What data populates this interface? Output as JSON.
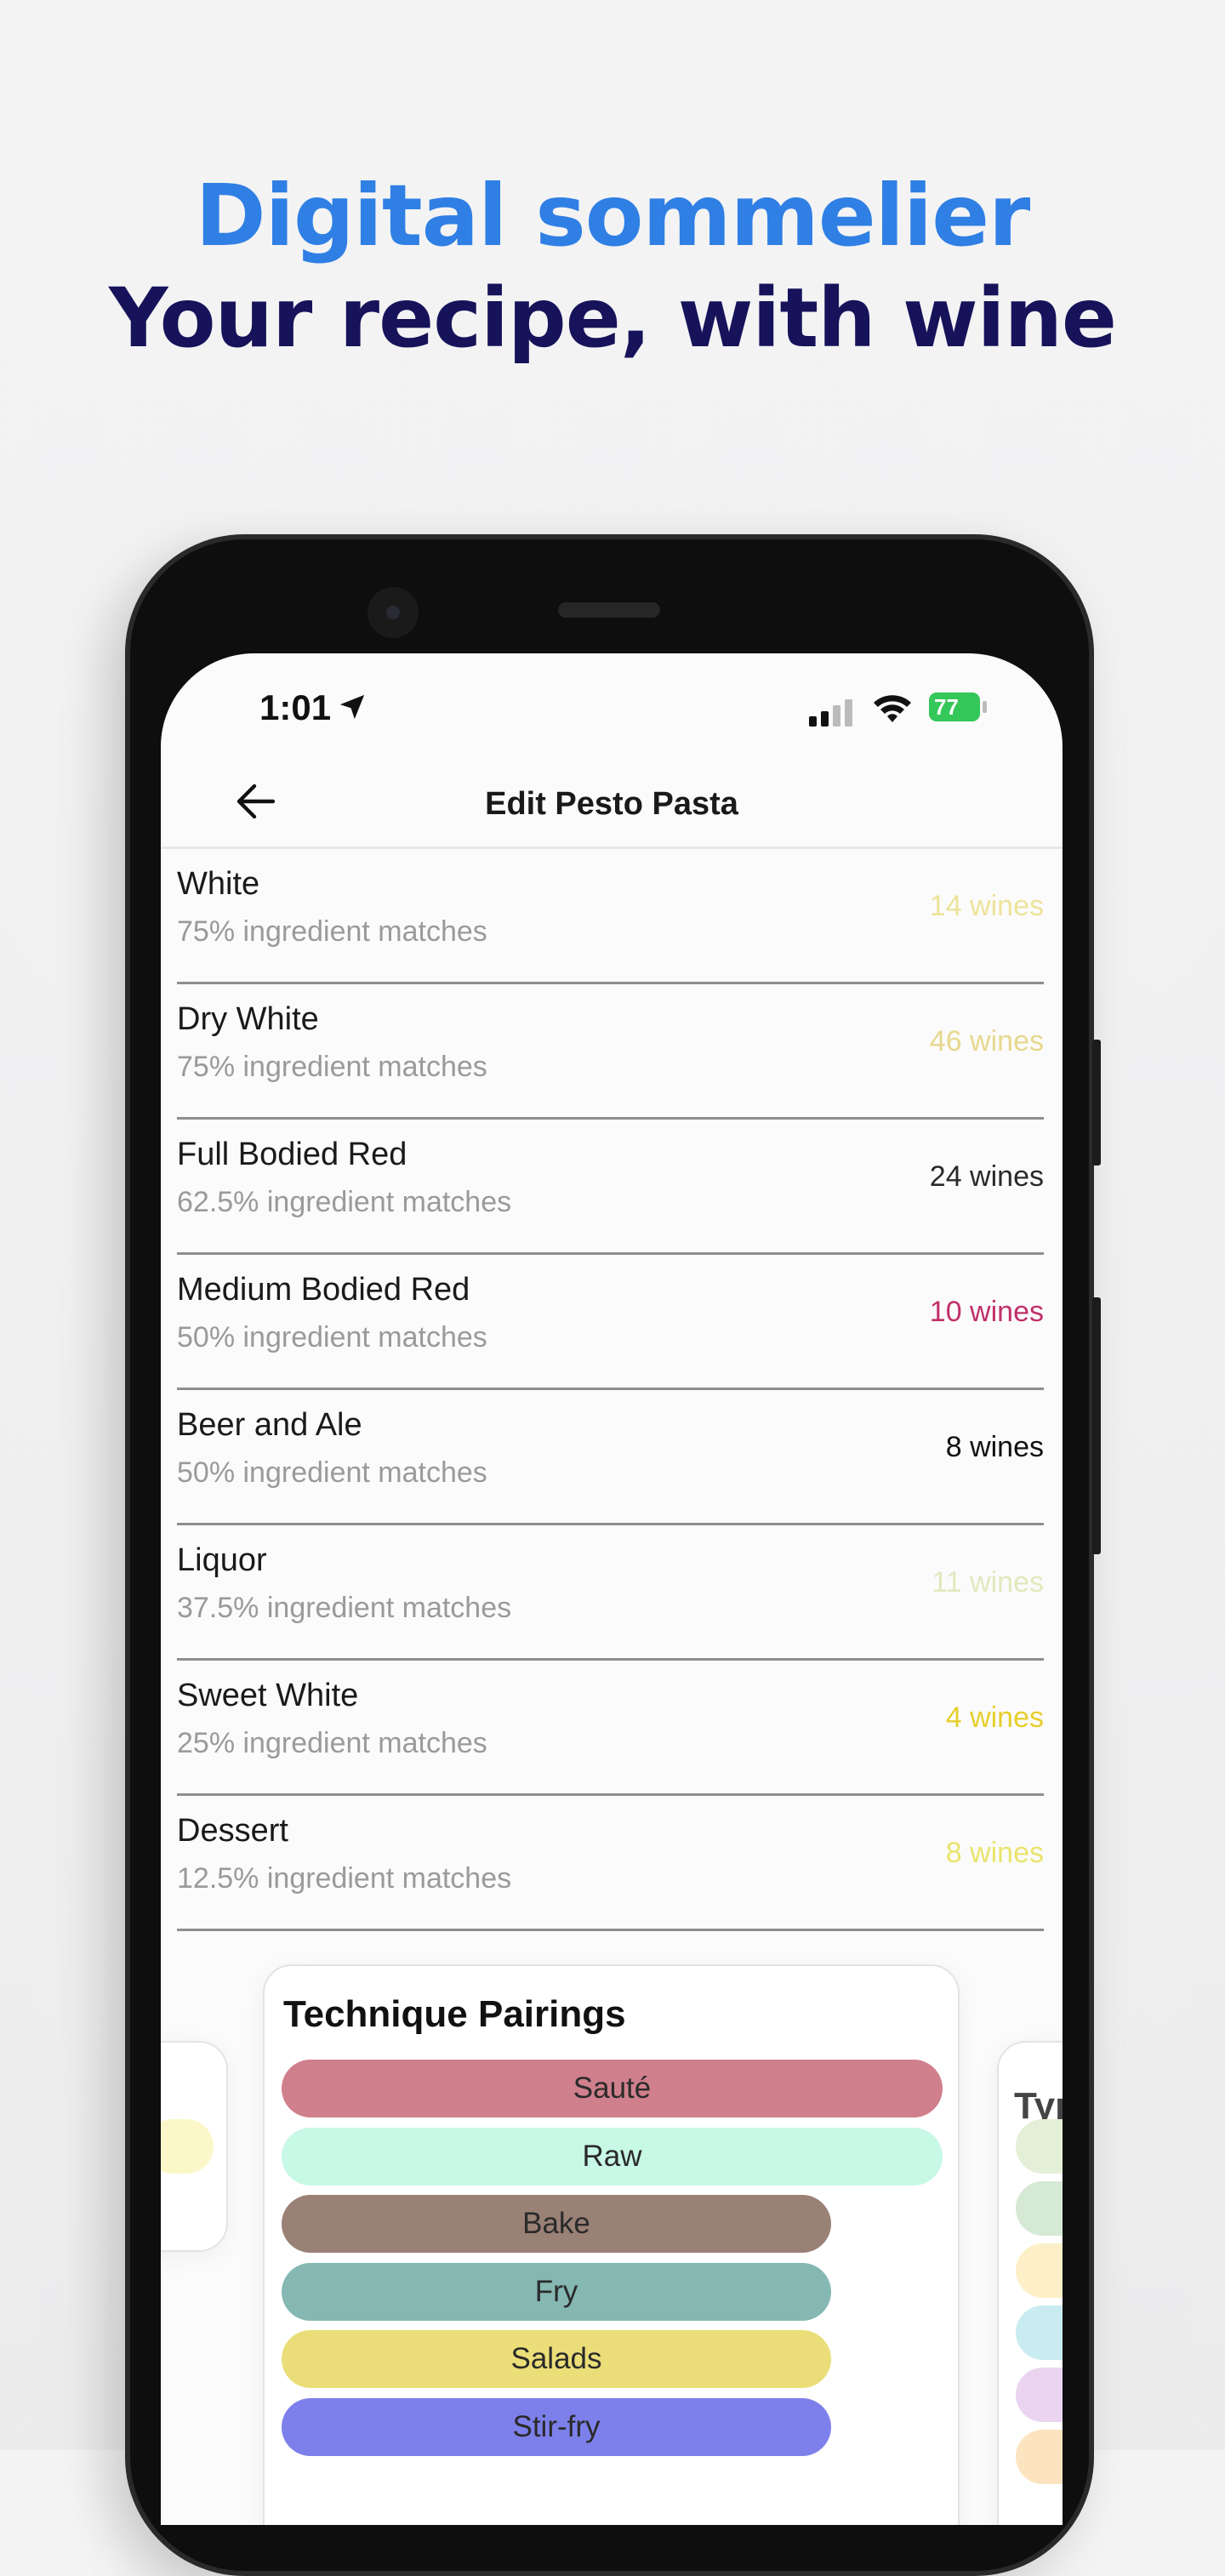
{
  "promo": {
    "headline": "Digital sommelier",
    "subheadline": "Your recipe, with wine",
    "headline_color": "#2f7fe4",
    "subheadline_color": "#16135a"
  },
  "status_bar": {
    "time": "1:01",
    "battery": "77",
    "icons": [
      "location-arrow-icon",
      "cellular-signal-icon",
      "wifi-icon",
      "battery-charging-icon"
    ]
  },
  "nav": {
    "title": "Edit Pesto Pasta",
    "back_icon": "arrow-left-icon"
  },
  "pairings": [
    {
      "name": "White",
      "match": "75% ingredient matches",
      "count": "14 wines",
      "color": "#ede39a"
    },
    {
      "name": "Dry White",
      "match": "75% ingredient matches",
      "count": "46 wines",
      "color": "#e6d88e"
    },
    {
      "name": "Full Bodied Red",
      "match": "62.5% ingredient matches",
      "count": "24 wines",
      "color": "#2a2a2a"
    },
    {
      "name": "Medium Bodied Red",
      "match": "50% ingredient matches",
      "count": "10 wines",
      "color": "#c0306a"
    },
    {
      "name": "Beer and Ale",
      "match": "50% ingredient matches",
      "count": "8 wines",
      "color": "#111111"
    },
    {
      "name": "Liquor",
      "match": "37.5% ingredient matches",
      "count": "11 wines",
      "color": "#dfe9bd"
    },
    {
      "name": "Sweet White",
      "match": "25% ingredient matches",
      "count": "4 wines",
      "color": "#e6cf2c"
    },
    {
      "name": "Dessert",
      "match": "12.5% ingredient matches",
      "count": "8 wines",
      "color": "#e9e46c"
    }
  ],
  "technique_card": {
    "title": "Technique Pairings",
    "items": [
      {
        "label": "Sauté",
        "color": "#d07f8c",
        "full": true
      },
      {
        "label": "Raw",
        "color": "#c8f8e6",
        "full": true
      },
      {
        "label": "Bake",
        "color": "#9a8176",
        "full": false
      },
      {
        "label": "Fry",
        "color": "#85b8b3",
        "full": false
      },
      {
        "label": "Salads",
        "color": "#ebde78",
        "full": false
      },
      {
        "label": "Stir-fry",
        "color": "#7d80ea",
        "full": false
      }
    ]
  },
  "right_card": {
    "title_partial": "Typ",
    "colors": [
      "#e4efd8",
      "#d6e9d4",
      "#fdf0c8",
      "#c8ecf0",
      "#ead4f0",
      "#fde4c0"
    ]
  },
  "left_card": {
    "colors": [
      "#fbf7c8"
    ]
  }
}
